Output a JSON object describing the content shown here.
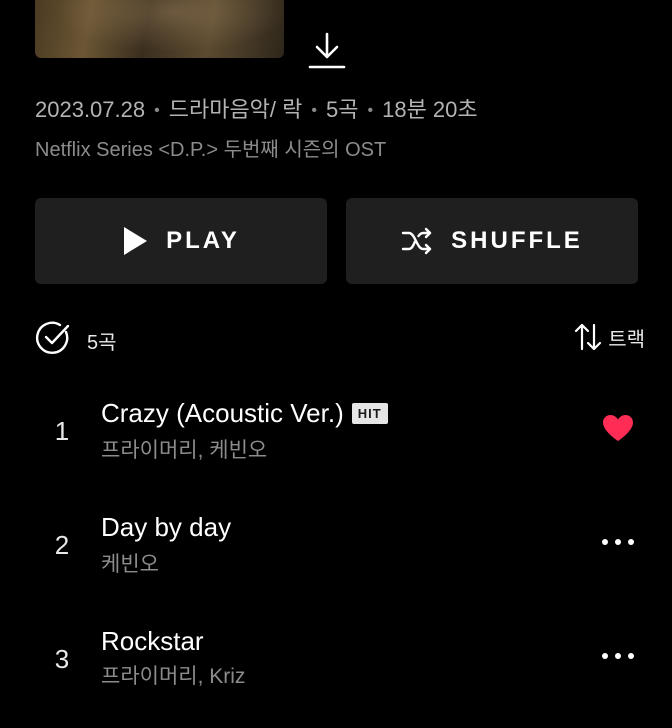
{
  "album": {
    "date": "2023.07.28",
    "genre": "드라마음악/ 락",
    "track_count": "5곡",
    "duration": "18분 20초",
    "subtitle": "Netflix Series <D.P.> 두번째 시즌의 OST"
  },
  "buttons": {
    "play_label": "PLAY",
    "shuffle_label": "SHUFFLE"
  },
  "tracklist_header": {
    "count_label": "5곡",
    "sort_label": "트랙"
  },
  "tracks": [
    {
      "number": "1",
      "title": "Crazy (Acoustic Ver.)",
      "badge": "HIT",
      "artist": "프라이머리, 케빈오",
      "liked": true
    },
    {
      "number": "2",
      "title": "Day by day",
      "artist": "케빈오",
      "liked": false
    },
    {
      "number": "3",
      "title": "Rockstar",
      "artist": "프라이머리, Kriz",
      "liked": false
    }
  ],
  "colors": {
    "background": "#000000",
    "button_bg": "#1f1f1f",
    "heart": "#ff2d55",
    "muted_text": "#8c8c8c"
  },
  "icons": [
    "download-icon",
    "play-icon",
    "shuffle-icon",
    "check-circle-icon",
    "sort-icon",
    "heart-icon",
    "more-icon"
  ]
}
